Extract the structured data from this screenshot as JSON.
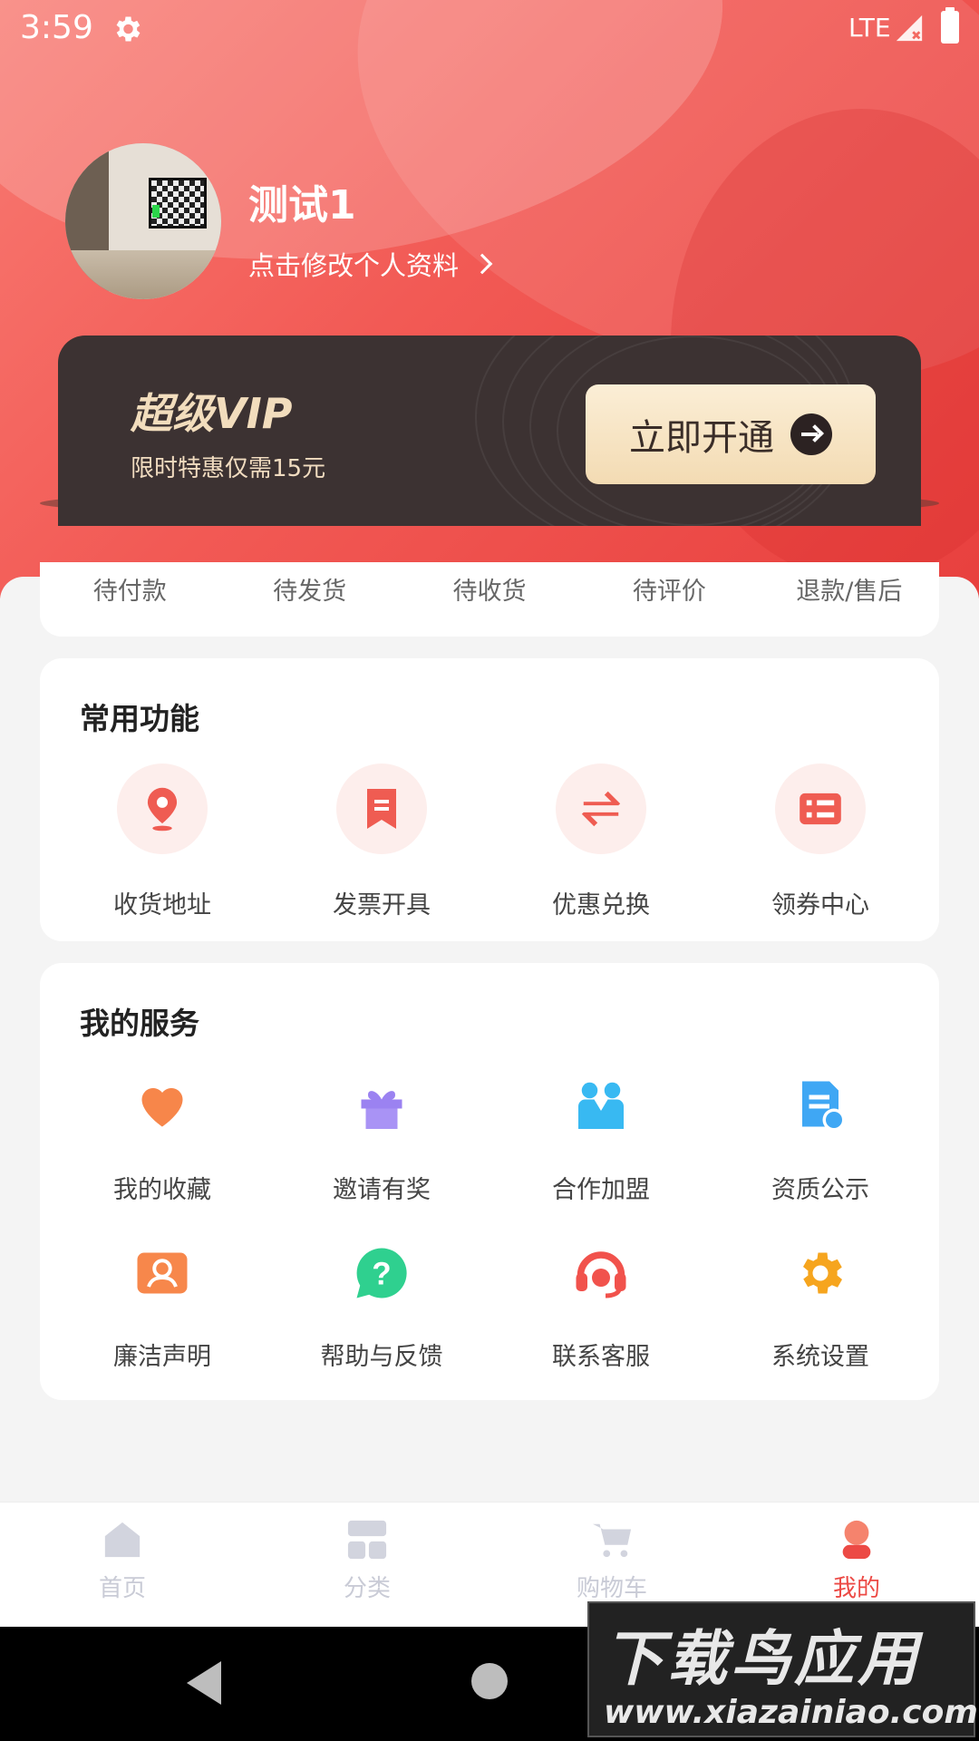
{
  "status_bar": {
    "time": "3:59",
    "network": "LTE"
  },
  "profile": {
    "username": "测试1",
    "edit_link": "点击修改个人资料"
  },
  "vip": {
    "title": "超级VIP",
    "subtitle": "限时特惠仅需15元",
    "button": "立即开通"
  },
  "orders": {
    "tabs": [
      "待付款",
      "待发货",
      "待收货",
      "待评价",
      "退款/售后"
    ]
  },
  "common_functions": {
    "title": "常用功能",
    "items": [
      {
        "label": "收货地址",
        "icon": "location-pin-icon"
      },
      {
        "label": "发票开具",
        "icon": "invoice-icon"
      },
      {
        "label": "优惠兑换",
        "icon": "exchange-icon"
      },
      {
        "label": "领券中心",
        "icon": "coupon-icon"
      }
    ]
  },
  "my_services": {
    "title": "我的服务",
    "items": [
      {
        "label": "我的收藏",
        "icon": "heart-icon"
      },
      {
        "label": "邀请有奖",
        "icon": "gift-icon"
      },
      {
        "label": "合作加盟",
        "icon": "partners-icon"
      },
      {
        "label": "资质公示",
        "icon": "certificate-icon"
      },
      {
        "label": "廉洁声明",
        "icon": "profile-card-icon"
      },
      {
        "label": "帮助与反馈",
        "icon": "help-icon"
      },
      {
        "label": "联系客服",
        "icon": "headset-icon"
      },
      {
        "label": "系统设置",
        "icon": "settings-icon"
      }
    ]
  },
  "bottom_nav": {
    "items": [
      {
        "label": "首页",
        "icon": "home-icon",
        "active": false
      },
      {
        "label": "分类",
        "icon": "category-icon",
        "active": false
      },
      {
        "label": "购物车",
        "icon": "cart-icon",
        "active": false
      },
      {
        "label": "我的",
        "icon": "user-icon",
        "active": true
      }
    ]
  },
  "watermark": {
    "line1": "下载鸟应用",
    "line2": "www.xiazainiao.com"
  },
  "colors": {
    "accent": "#ec4a45",
    "vip_dark": "#3c3232",
    "vip_gold": "#f2ddbd",
    "background": "#f4f4f4"
  }
}
